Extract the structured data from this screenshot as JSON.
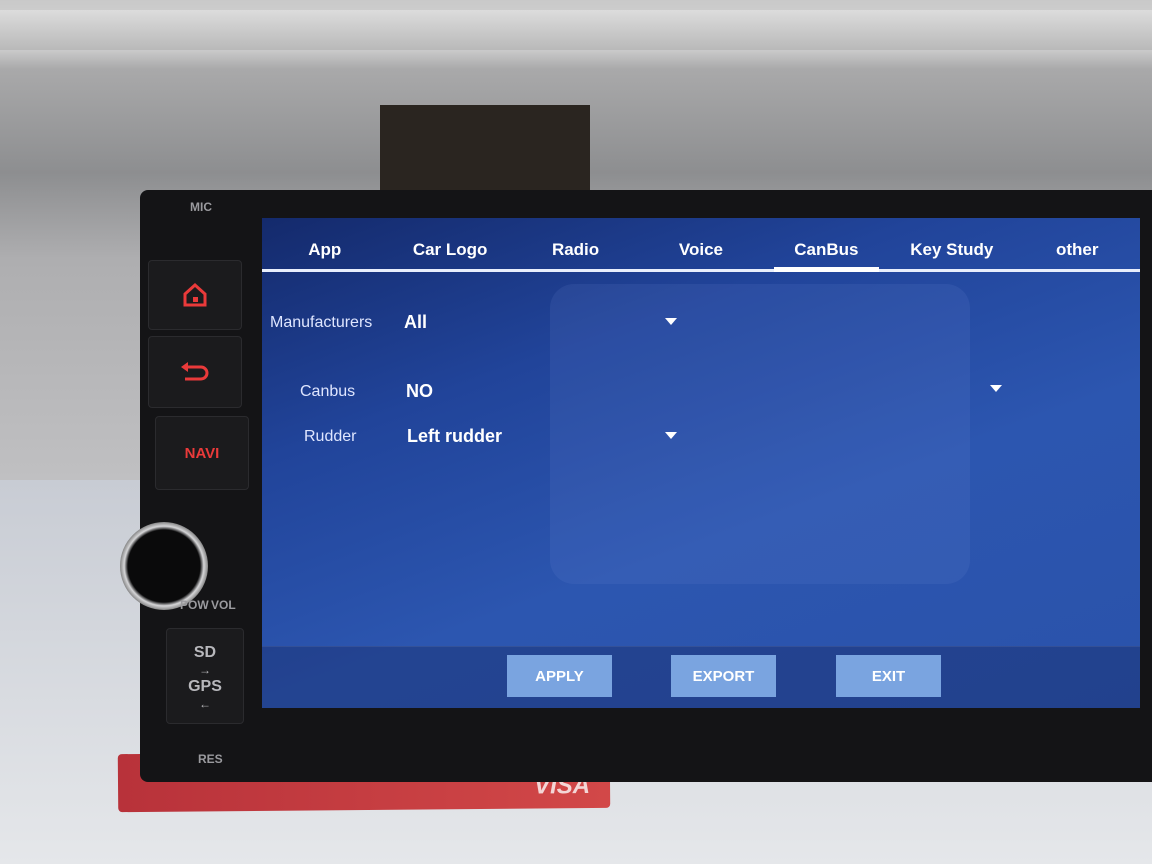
{
  "device": {
    "mic_label": "MIC",
    "navi_label": "NAVI",
    "vol_label": "VOL",
    "pow_label": "POW",
    "sd_label": "SD",
    "gps_label": "GPS",
    "res_label": "RES",
    "card_label": "VISA",
    "button_color": "#ea3a3a"
  },
  "tabs": [
    {
      "label": "App"
    },
    {
      "label": "Car Logo"
    },
    {
      "label": "Radio"
    },
    {
      "label": "Voice"
    },
    {
      "label": "CanBus",
      "active": true
    },
    {
      "label": "Key Study"
    },
    {
      "label": "other"
    }
  ],
  "settings": {
    "manufacturers": {
      "label": "Manufacturers",
      "value": "All"
    },
    "canbus": {
      "label": "Canbus",
      "value": "NO"
    },
    "rudder": {
      "label": "Rudder",
      "value": "Left rudder"
    }
  },
  "actions": {
    "apply": "APPLY",
    "export": "EXPORT",
    "exit": "EXIT"
  },
  "colors": {
    "screen_bg": "#2a52aa",
    "button_bg": "#7aa4e0"
  }
}
